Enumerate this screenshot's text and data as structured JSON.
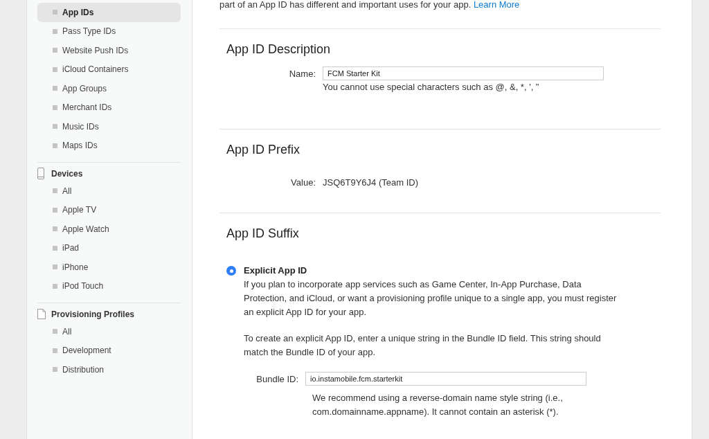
{
  "intro": {
    "text": "part of an App ID has different and important uses for your app.",
    "link": "Learn More"
  },
  "sidebar": {
    "sections": [
      {
        "items": [
          {
            "label": "App IDs",
            "selected": true
          },
          {
            "label": "Pass Type IDs",
            "selected": false
          },
          {
            "label": "Website Push IDs",
            "selected": false
          },
          {
            "label": "iCloud Containers",
            "selected": false
          },
          {
            "label": "App Groups",
            "selected": false
          },
          {
            "label": "Merchant IDs",
            "selected": false
          },
          {
            "label": "Music IDs",
            "selected": false
          },
          {
            "label": "Maps IDs",
            "selected": false
          }
        ]
      },
      {
        "title": "Devices",
        "items": [
          {
            "label": "All",
            "selected": false
          },
          {
            "label": "Apple TV",
            "selected": false
          },
          {
            "label": "Apple Watch",
            "selected": false
          },
          {
            "label": "iPad",
            "selected": false
          },
          {
            "label": "iPhone",
            "selected": false
          },
          {
            "label": "iPod Touch",
            "selected": false
          }
        ]
      },
      {
        "title": "Provisioning Profiles",
        "items": [
          {
            "label": "All",
            "selected": false
          },
          {
            "label": "Development",
            "selected": false
          },
          {
            "label": "Distribution",
            "selected": false
          }
        ]
      }
    ]
  },
  "sections": [
    {
      "title": "App ID Description",
      "rows": [
        {
          "kind": "field",
          "label": "Name:",
          "value": "FCM Starter Kit",
          "hint": "You cannot use special characters such as @, &, *, ', \""
        }
      ]
    },
    {
      "title": "App ID Prefix",
      "rows": [
        {
          "kind": "value",
          "label": "Value:",
          "text": "JSQ6T9Y6J4 (Team ID)"
        }
      ]
    },
    {
      "title": "App ID Suffix",
      "rows": [
        {
          "kind": "option",
          "label": "Explicit App ID",
          "selected": true,
          "paragraphs": [
            "If you plan to incorporate app services such as Game Center, In-App Purchase, Data Protection, and iCloud, or want a provisioning profile unique to a single app, you must register an explicit App ID for your app.",
            "To create an explicit App ID, enter a unique string in the Bundle ID field. This string should match the Bundle ID of your app."
          ],
          "field": {
            "label": "Bundle ID:",
            "value": "io.instamobile.fcm.starterkit",
            "hint": "We recommend using a reverse-domain name style string (i.e., com.domainname.appname). It cannot contain an asterisk (*)."
          }
        }
      ]
    }
  ]
}
